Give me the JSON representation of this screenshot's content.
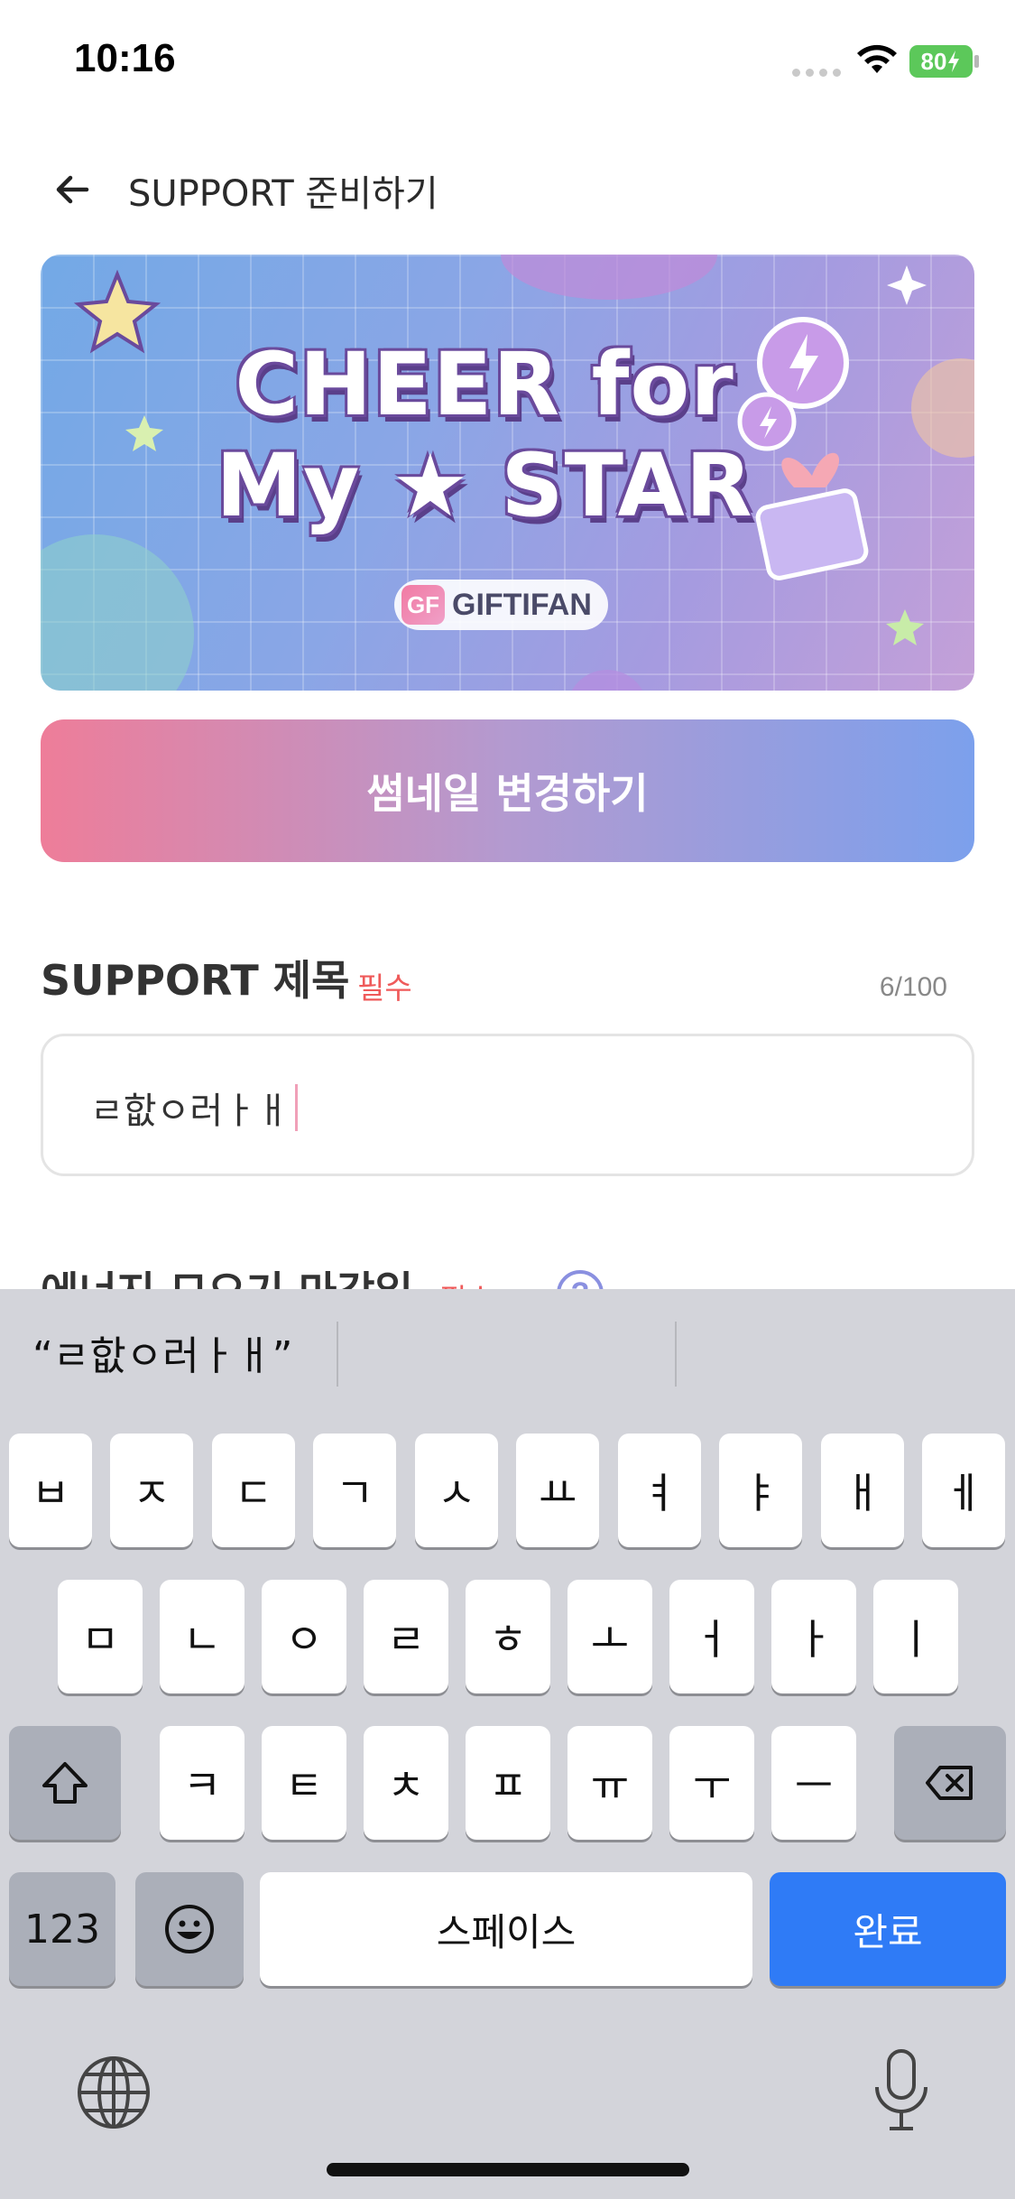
{
  "status_bar": {
    "time": "10:16",
    "battery": "80",
    "battery_color": "#5cc85a"
  },
  "header": {
    "title": "SUPPORT 준비하기",
    "back_icon": "arrow-left-icon"
  },
  "banner": {
    "line1": "CHEER for",
    "line2": "My ★ STAR",
    "brand_logo": "GF",
    "brand_name": "GIFTIFAN"
  },
  "thumbnail_button": {
    "label": "썸네일 변경하기",
    "gradient": [
      "#ee7d99",
      "#b39ad0",
      "#7ca0ec"
    ]
  },
  "support_title": {
    "label": "SUPPORT 제목",
    "required": "필수",
    "count": "6/100",
    "value": "ㄹ핪ㅇ러ㅏㅐ"
  },
  "next_section": {
    "label": "에너지 모으기 마감일",
    "required": "필수",
    "help_icon": "question-circle-icon"
  },
  "keyboard": {
    "suggestions": [
      "“ㄹ핪ㅇ러ㅏㅐ”",
      "",
      ""
    ],
    "row1": [
      "ㅂ",
      "ㅈ",
      "ㄷ",
      "ㄱ",
      "ㅅ",
      "ㅛ",
      "ㅕ",
      "ㅑ",
      "ㅐ",
      "ㅔ"
    ],
    "row2": [
      "ㅁ",
      "ㄴ",
      "ㅇ",
      "ㄹ",
      "ㅎ",
      "ㅗ",
      "ㅓ",
      "ㅏ",
      "ㅣ"
    ],
    "row3": [
      "ㅋ",
      "ㅌ",
      "ㅊ",
      "ㅍ",
      "ㅠ",
      "ㅜ",
      "ㅡ"
    ],
    "numbers_key": "123",
    "space_key": "스페이스",
    "done_key": "완료",
    "accent": "#2f7bf6"
  }
}
